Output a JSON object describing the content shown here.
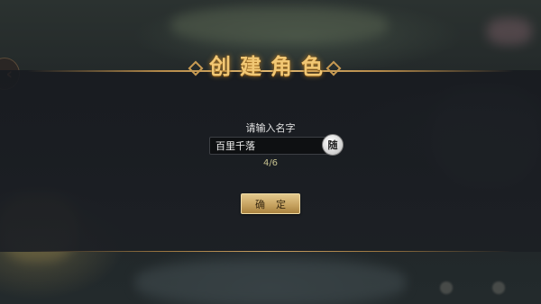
{
  "dialog": {
    "title": "创建角色",
    "prompt": "请输入名字",
    "name_input": {
      "value": "百里千落",
      "placeholder": ""
    },
    "random_button_label": "随",
    "counter": "4/6",
    "confirm_label": "确定"
  },
  "nav": {
    "back_icon": "back-arrow-icon",
    "back_glyph": "‹"
  },
  "colors": {
    "accent": "#f1c774",
    "panel": "#1c1f24",
    "button": "#c8a462"
  }
}
